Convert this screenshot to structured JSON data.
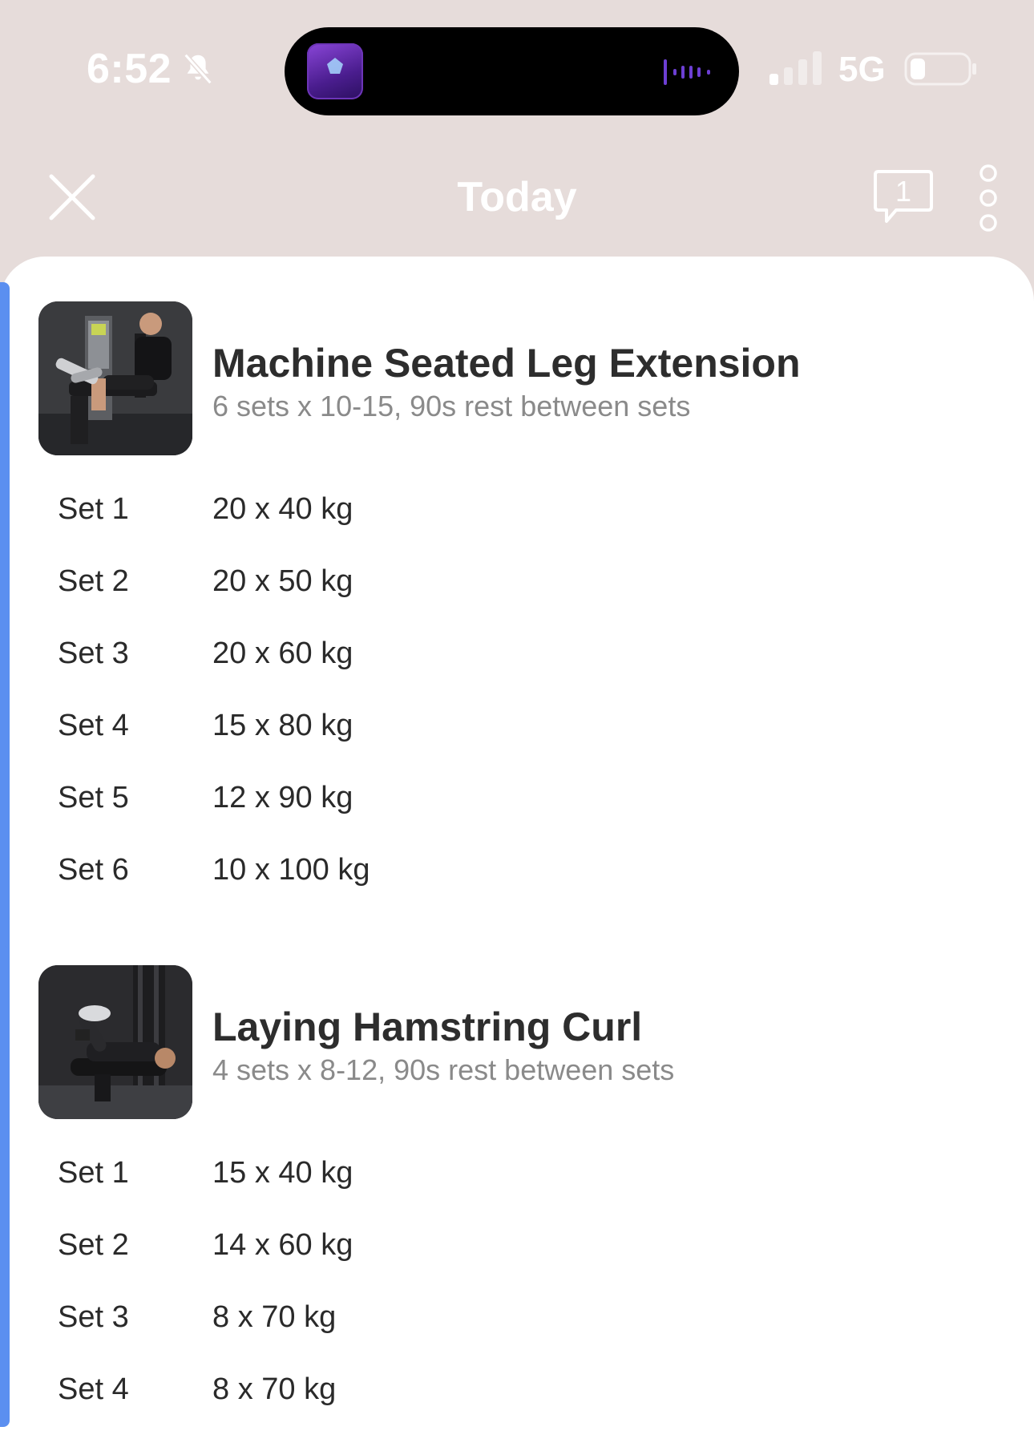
{
  "status_bar": {
    "time": "6:52",
    "network": "5G",
    "icons": [
      "bell-slash-icon",
      "signal-icon",
      "battery-icon"
    ]
  },
  "nav": {
    "title": "Today",
    "chat_count": "1",
    "icons": [
      "close-icon",
      "chat-bubble-icon",
      "more-vertical-icon"
    ]
  },
  "exercises": [
    {
      "name": "Machine Seated Leg Extension",
      "meta": "6 sets x 10-15, 90s rest between sets",
      "sets": [
        {
          "label": "Set 1",
          "value": "20 x 40 kg"
        },
        {
          "label": "Set 2",
          "value": "20 x 50 kg"
        },
        {
          "label": "Set 3",
          "value": "20 x 60 kg"
        },
        {
          "label": "Set 4",
          "value": "15 x 80 kg"
        },
        {
          "label": "Set 5",
          "value": "12 x 90 kg"
        },
        {
          "label": "Set 6",
          "value": "10 x 100 kg"
        }
      ]
    },
    {
      "name": "Laying Hamstring Curl",
      "meta": "4 sets x 8-12, 90s rest between sets",
      "sets": [
        {
          "label": "Set 1",
          "value": "15 x 40 kg"
        },
        {
          "label": "Set 2",
          "value": "14 x 60 kg"
        },
        {
          "label": "Set 3",
          "value": "8 x 70 kg"
        },
        {
          "label": "Set 4",
          "value": "8 x 70 kg"
        }
      ]
    }
  ],
  "colors": {
    "header_bg": "#e6dcda",
    "accent": "#5b8ff0",
    "text": "#2d2d2d",
    "muted": "#8a8a8a"
  }
}
